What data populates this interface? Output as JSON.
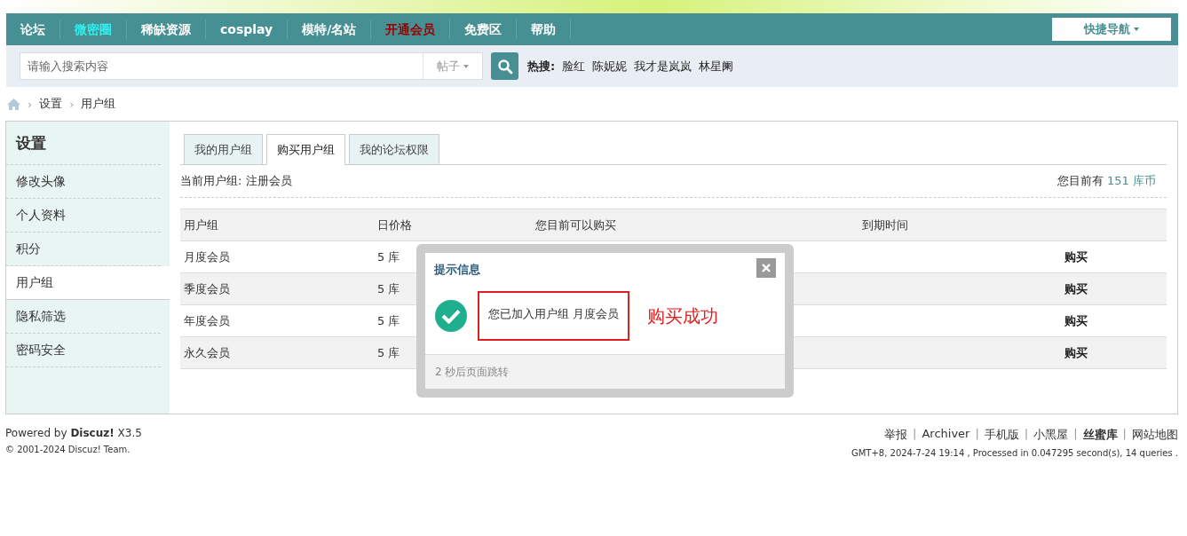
{
  "nav": {
    "items": [
      {
        "label": "论坛",
        "color": "#ffffff"
      },
      {
        "label": "微密圈",
        "color": "#33eeee"
      },
      {
        "label": "稀缺资源",
        "color": "#ffffff"
      },
      {
        "label": "cosplay",
        "color": "#ffffff"
      },
      {
        "label": "模特/名站",
        "color": "#ffffff"
      },
      {
        "label": "开通会员",
        "color": "#9a0000"
      },
      {
        "label": "免费区",
        "color": "#ffffff"
      },
      {
        "label": "帮助",
        "color": "#ffffff"
      }
    ],
    "quick_nav": "快捷导航"
  },
  "search": {
    "placeholder": "请输入搜索内容",
    "type": "帖子",
    "hot_label": "热搜:",
    "hot": [
      "脸红",
      "陈妮妮",
      "我才是岚岚",
      "林星阑"
    ]
  },
  "breadcrumb": [
    {
      "sep": "›",
      "label": "设置"
    },
    {
      "sep": "›",
      "label": "用户组"
    }
  ],
  "sidebar": {
    "title": "设置",
    "items": [
      {
        "label": "修改头像",
        "selected": false
      },
      {
        "label": "个人资料",
        "selected": false
      },
      {
        "label": "积分",
        "selected": false
      },
      {
        "label": "用户组",
        "selected": true
      },
      {
        "label": "隐私筛选",
        "selected": false
      },
      {
        "label": "密码安全",
        "selected": false
      }
    ]
  },
  "tabs": [
    {
      "label": "我的用户组",
      "selected": false
    },
    {
      "label": "购买用户组",
      "selected": true
    },
    {
      "label": "我的论坛权限",
      "selected": false
    }
  ],
  "current_group": "当前用户组: 注册会员",
  "balance_label": "您目前有",
  "balance": "151 库币",
  "table": {
    "columns": [
      "用户组",
      "日价格",
      "您目前可以购买",
      "到期时间"
    ],
    "rows": [
      {
        "name": "月度会员",
        "price": "5 库",
        "action": "购买"
      },
      {
        "name": "季度会员",
        "price": "5 库",
        "action": "购买"
      },
      {
        "name": "年度会员",
        "price": "5 库",
        "action": "购买"
      },
      {
        "name": "永久会员",
        "price": "5 库",
        "action": "购买"
      }
    ]
  },
  "dialog": {
    "title": "提示信息",
    "message": "您已加入用户组 月度会员",
    "annotation": "购买成功",
    "footer": "2 秒后页面跳转"
  },
  "footer": {
    "powered": "Powered by **Discuz!** X3.5",
    "copyright": "© 2001-2024 Discuz! Team.",
    "links": [
      {
        "label": "举报",
        "bold": false
      },
      {
        "sep": "|",
        "label": "Archiver",
        "bold": false
      },
      {
        "sep": "|",
        "label": "手机版",
        "bold": false
      },
      {
        "sep": "|",
        "label": "小黑屋",
        "bold": false
      },
      {
        "sep": "|",
        "label": "丝蜜库",
        "bold": true
      },
      {
        "sep": "|",
        "label": "网站地图",
        "bold": false
      }
    ],
    "info": "GMT+8, 2024-7-24 19:14 , Processed in 0.047295 second(s), 14 queries ."
  }
}
